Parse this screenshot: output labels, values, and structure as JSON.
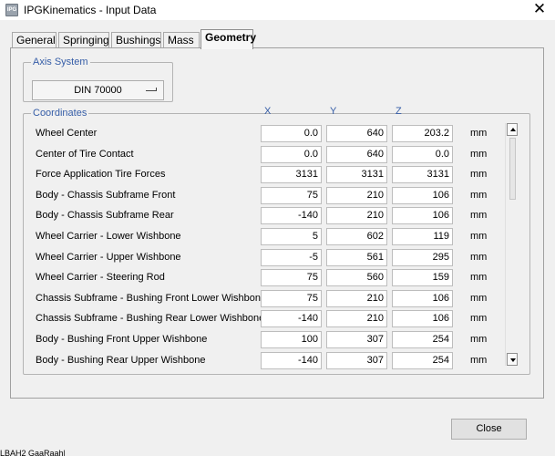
{
  "window": {
    "title": "IPGKinematics - Input Data",
    "icon_text": "IPG",
    "close_glyph": "✕"
  },
  "tabs": [
    {
      "label": "General",
      "active": false
    },
    {
      "label": "Springing",
      "active": false
    },
    {
      "label": "Bushings",
      "active": false
    },
    {
      "label": "Mass",
      "active": false
    },
    {
      "label": "Geometry",
      "active": true
    }
  ],
  "axis_system": {
    "legend": "Axis System",
    "value": "DIN 70000"
  },
  "coordinates": {
    "legend": "Coordinates",
    "headers": {
      "x": "X",
      "y": "Y",
      "z": "Z"
    },
    "rows": [
      {
        "label": "Wheel Center",
        "x": "0.0",
        "y": "640",
        "z": "203.2",
        "unit": "mm"
      },
      {
        "label": "Center of Tire Contact",
        "x": "0.0",
        "y": "640",
        "z": "0.0",
        "unit": "mm"
      },
      {
        "label": "Force Application Tire Forces",
        "x": "3131",
        "y": "3131",
        "z": "3131",
        "unit": "mm"
      },
      {
        "label": "Body - Chassis Subframe Front",
        "x": "75",
        "y": "210",
        "z": "106",
        "unit": "mm"
      },
      {
        "label": "Body - Chassis Subframe Rear",
        "x": "-140",
        "y": "210",
        "z": "106",
        "unit": "mm"
      },
      {
        "label": "Wheel Carrier - Lower Wishbone",
        "x": "5",
        "y": "602",
        "z": "119",
        "unit": "mm"
      },
      {
        "label": "Wheel Carrier - Upper Wishbone",
        "x": "-5",
        "y": "561",
        "z": "295",
        "unit": "mm"
      },
      {
        "label": "Wheel Carrier - Steering Rod",
        "x": "75",
        "y": "560",
        "z": "159",
        "unit": "mm"
      },
      {
        "label": "Chassis Subframe - Bushing Front Lower Wishbone",
        "x": "75",
        "y": "210",
        "z": "106",
        "unit": "mm"
      },
      {
        "label": "Chassis Subframe - Bushing Rear Lower Wishbone",
        "x": "-140",
        "y": "210",
        "z": "106",
        "unit": "mm"
      },
      {
        "label": "Body - Bushing Front Upper Wishbone",
        "x": "100",
        "y": "307",
        "z": "254",
        "unit": "mm"
      },
      {
        "label": "Body - Bushing Rear Upper Wishbone",
        "x": "-140",
        "y": "307",
        "z": "254",
        "unit": "mm"
      }
    ]
  },
  "buttons": {
    "close": "Close"
  },
  "status_text": "LBAH2 GaaRaah|"
}
